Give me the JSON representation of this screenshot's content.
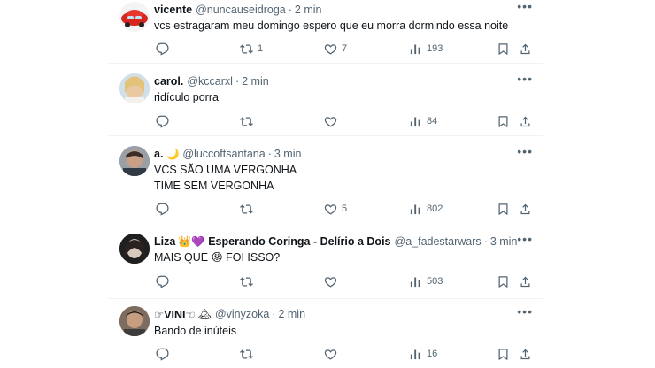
{
  "posts": [
    {
      "name": "vicente",
      "emojis": "",
      "handle": "@nuncauseidroga",
      "time": "2 min",
      "text": "vcs estragaram meu domingo espero que eu morra dormindo essa noite",
      "replies": "",
      "retweets": "1",
      "likes": "7",
      "views": "193",
      "avatar_color": "#d8261f"
    },
    {
      "name": "carol.",
      "emojis": "",
      "handle": "@kccarxl",
      "time": "2 min",
      "text": "ridículo porra",
      "replies": "",
      "retweets": "",
      "likes": "",
      "views": "84",
      "avatar_color": "#d9b99a"
    },
    {
      "name": "a.",
      "emojis": "🌙",
      "handle": "@luccoftsantana",
      "time": "3 min",
      "text": "VCS SÃO UMA VERGONHA\nTIME SEM VERGONHA",
      "replies": "",
      "retweets": "",
      "likes": "5",
      "views": "802",
      "avatar_color": "#7a7f86"
    },
    {
      "name": "Liza",
      "emojis": "👑💜",
      "name2": "Esperando Coringa - Delírio a Dois",
      "handle": "@a_fadestarwars",
      "time": "3 min",
      "text": "MAIS QUE 😡 FOI ISSO?",
      "replies": "",
      "retweets": "",
      "likes": "",
      "views": "503",
      "avatar_color": "#2b2b2b"
    },
    {
      "name": "☞VINI☜",
      "emojis": "🏔",
      "handle": "@vinyzoka",
      "time": "2 min",
      "text": "Bando de inúteis",
      "replies": "",
      "retweets": "",
      "likes": "",
      "views": "16",
      "avatar_color": "#6b5a4e"
    }
  ],
  "ui": {
    "dot": "·",
    "more": "•••"
  },
  "colors": {
    "muted": "#536471",
    "text": "#0f1419",
    "divider": "#eff3f4"
  },
  "icons": [
    "reply-icon",
    "retweet-icon",
    "like-icon",
    "views-icon",
    "bookmark-icon",
    "share-icon",
    "more-icon"
  ]
}
